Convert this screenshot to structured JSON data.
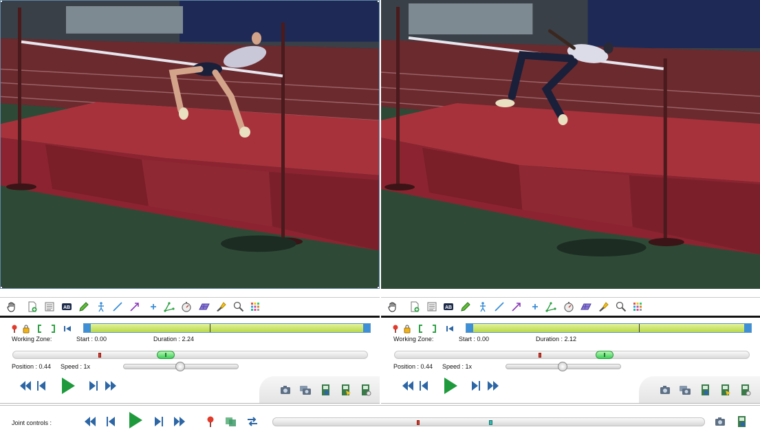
{
  "colors": {
    "play_green": "#1e9a3c",
    "nav_blue": "#2c66a5",
    "zone_green": "#b8d84a",
    "zone_border": "#5b97c9",
    "marker_red": "#e23a2a",
    "marker_teal": "#35b9b0"
  },
  "toolbar": {
    "icons": [
      "hand-icon",
      "add-keyframe-icon",
      "notes-icon",
      "text-label-icon",
      "pencil-icon",
      "human-model-icon",
      "line-icon",
      "arrow-icon",
      "cross-marker-icon",
      "angle-icon",
      "chronometer-icon",
      "grid-plane-icon",
      "spotlight-icon",
      "magnifier-icon",
      "color-palette-icon"
    ]
  },
  "players": [
    {
      "working_zone_label": "Working Zone:",
      "start_text": "Start : 0.00",
      "duration_text": "Duration : 2.24",
      "position_text": "Position : 0.44",
      "speed_text": "Speed : 1x",
      "position_fraction": 0.244,
      "cursor_fraction": 0.43,
      "speed_fraction": 0.49
    },
    {
      "working_zone_label": "Working Zone:",
      "start_text": "Start : 0.00",
      "duration_text": "Duration : 2.12",
      "position_text": "Position : 0.44",
      "speed_text": "Speed : 1x",
      "position_fraction": 0.409,
      "cursor_fraction": 0.59,
      "speed_fraction": 0.49
    }
  ],
  "joint": {
    "label": "Joint controls :",
    "sync_fraction": 0.336,
    "cursor_fraction": 0.503
  }
}
